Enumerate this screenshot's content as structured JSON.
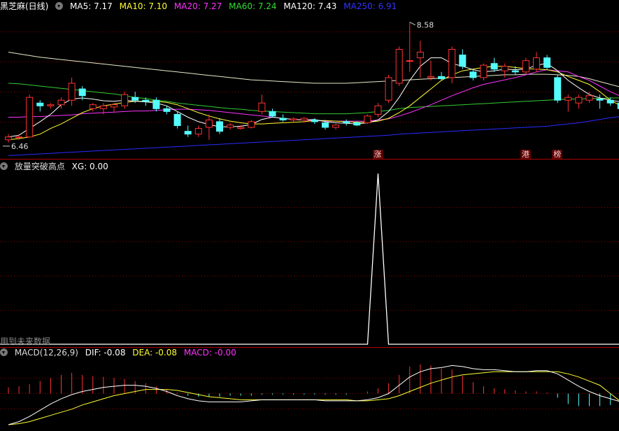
{
  "header1": {
    "title": "黑芝麻(日线)",
    "items": [
      {
        "label": "MA5: 7.17",
        "color": "#ffffff"
      },
      {
        "label": "MA10: 7.10",
        "color": "#ffff33"
      },
      {
        "label": "MA20: 7.27",
        "color": "#ff33ff"
      },
      {
        "label": "MA60: 7.24",
        "color": "#33dd33"
      },
      {
        "label": "MA120: 7.43",
        "color": "#ffffff"
      },
      {
        "label": "MA250: 6.91",
        "color": "#3333ff"
      }
    ]
  },
  "header2": {
    "title": "放量突破高点",
    "items": [
      {
        "label": "XG: 0.00",
        "color": "#ffffff"
      }
    ]
  },
  "header3": {
    "title": "MACD(12,26,9)",
    "items": [
      {
        "label": "DIF: -0.08",
        "color": "#ffffff"
      },
      {
        "label": "DEA: -0.08",
        "color": "#ffff33"
      },
      {
        "label": "MACD: -0.00",
        "color": "#ff33ff"
      }
    ]
  },
  "future_note": "用到未来数据",
  "badges": [
    {
      "text": "涨",
      "bar": 35
    },
    {
      "text": "港",
      "bar": 49
    },
    {
      "text": "榜",
      "bar": 52
    }
  ],
  "price_labels": {
    "high": "8.58",
    "low": "6.46"
  },
  "colors": {
    "up": "#ff3232",
    "down": "#54fcfc",
    "grid": "#8b0000"
  },
  "chart_data": [
    {
      "type": "candlestick",
      "series_names": [
        "MA5",
        "MA10",
        "MA20",
        "MA60",
        "MA120",
        "MA250"
      ],
      "ylim": [
        6.2,
        8.75
      ],
      "candles": [
        [
          6.5,
          6.6,
          6.45,
          6.55
        ],
        [
          6.55,
          6.6,
          6.5,
          6.55
        ],
        [
          6.55,
          7.3,
          6.55,
          7.25
        ],
        [
          7.15,
          7.2,
          7.0,
          7.1
        ],
        [
          7.1,
          7.15,
          7.05,
          7.12
        ],
        [
          7.12,
          7.25,
          7.05,
          7.2
        ],
        [
          7.2,
          7.6,
          7.1,
          7.5
        ],
        [
          7.4,
          7.45,
          7.2,
          7.28
        ],
        [
          7.05,
          7.15,
          7.0,
          7.12
        ],
        [
          7.05,
          7.15,
          6.95,
          7.1
        ],
        [
          7.08,
          7.15,
          7.0,
          7.12
        ],
        [
          7.1,
          7.35,
          7.05,
          7.3
        ],
        [
          7.25,
          7.35,
          7.15,
          7.2
        ],
        [
          7.2,
          7.25,
          7.1,
          7.18
        ],
        [
          7.2,
          7.25,
          7.0,
          7.05
        ],
        [
          7.05,
          7.1,
          6.95,
          7.0
        ],
        [
          6.95,
          7.0,
          6.7,
          6.75
        ],
        [
          6.65,
          6.75,
          6.55,
          6.6
        ],
        [
          6.6,
          6.75,
          6.55,
          6.7
        ],
        [
          6.72,
          6.95,
          6.5,
          6.85
        ],
        [
          6.82,
          6.88,
          6.6,
          6.65
        ],
        [
          6.72,
          6.8,
          6.68,
          6.76
        ],
        [
          6.7,
          6.76,
          6.68,
          6.72
        ],
        [
          6.72,
          6.85,
          6.7,
          6.82
        ],
        [
          7.0,
          7.3,
          6.95,
          7.15
        ],
        [
          7.0,
          7.05,
          6.9,
          6.92
        ],
        [
          6.88,
          6.95,
          6.82,
          6.85
        ],
        [
          6.85,
          6.9,
          6.82,
          6.87
        ],
        [
          6.85,
          6.9,
          6.8,
          6.88
        ],
        [
          6.85,
          6.88,
          6.78,
          6.82
        ],
        [
          6.8,
          6.85,
          6.68,
          6.72
        ],
        [
          6.72,
          6.78,
          6.68,
          6.76
        ],
        [
          6.82,
          6.86,
          6.75,
          6.8
        ],
        [
          6.8,
          6.83,
          6.74,
          6.76
        ],
        [
          6.8,
          6.95,
          6.78,
          6.92
        ],
        [
          6.95,
          7.15,
          6.9,
          7.1
        ],
        [
          7.2,
          7.65,
          7.15,
          7.6
        ],
        [
          7.5,
          8.15,
          7.45,
          8.1
        ],
        [
          7.9,
          8.58,
          7.7,
          7.9
        ],
        [
          7.95,
          8.25,
          7.6,
          8.05
        ],
        [
          7.6,
          7.9,
          7.55,
          7.62
        ],
        [
          7.62,
          7.7,
          7.55,
          7.58
        ],
        [
          7.6,
          8.15,
          7.5,
          8.1
        ],
        [
          8.0,
          8.1,
          7.75,
          7.8
        ],
        [
          7.7,
          7.75,
          7.55,
          7.6
        ],
        [
          7.6,
          7.85,
          7.55,
          7.82
        ],
        [
          7.85,
          7.95,
          7.7,
          7.75
        ],
        [
          7.72,
          7.85,
          7.6,
          7.8
        ],
        [
          7.72,
          7.8,
          7.65,
          7.7
        ],
        [
          7.7,
          7.95,
          7.65,
          7.9
        ],
        [
          7.75,
          8.05,
          7.7,
          7.95
        ],
        [
          7.95,
          8.0,
          7.75,
          7.78
        ],
        [
          7.6,
          7.65,
          7.15,
          7.2
        ],
        [
          7.2,
          7.3,
          7.0,
          7.25
        ],
        [
          7.15,
          7.3,
          7.05,
          7.25
        ],
        [
          7.2,
          7.35,
          7.15,
          7.28
        ],
        [
          7.22,
          7.3,
          7.05,
          7.2
        ],
        [
          7.2,
          7.25,
          7.1,
          7.15
        ],
        [
          7.15,
          7.2,
          6.95,
          7.05
        ]
      ],
      "ma5": [
        6.55,
        6.58,
        6.7,
        6.82,
        6.95,
        7.12,
        7.22,
        7.24,
        7.22,
        7.19,
        7.18,
        7.2,
        7.18,
        7.17,
        7.15,
        7.1,
        7.0,
        6.9,
        6.82,
        6.77,
        6.73,
        6.73,
        6.74,
        6.77,
        6.86,
        6.9,
        6.88,
        6.86,
        6.85,
        6.86,
        6.82,
        6.8,
        6.79,
        6.78,
        6.8,
        6.85,
        7.0,
        7.25,
        7.55,
        7.8,
        7.95,
        7.95,
        7.85,
        7.8,
        7.74,
        7.7,
        7.72,
        7.75,
        7.74,
        7.75,
        7.82,
        7.85,
        7.72,
        7.55,
        7.42,
        7.3,
        7.24,
        7.2,
        7.17
      ],
      "ma10": [
        6.5,
        6.52,
        6.55,
        6.6,
        6.7,
        6.78,
        6.88,
        6.98,
        7.05,
        7.1,
        7.13,
        7.16,
        7.18,
        7.18,
        7.18,
        7.16,
        7.12,
        7.05,
        6.98,
        6.92,
        6.87,
        6.83,
        6.8,
        6.78,
        6.78,
        6.79,
        6.8,
        6.81,
        6.82,
        6.84,
        6.84,
        6.83,
        6.82,
        6.81,
        6.81,
        6.83,
        6.88,
        6.98,
        7.1,
        7.25,
        7.4,
        7.55,
        7.65,
        7.72,
        7.75,
        7.78,
        7.8,
        7.8,
        7.78,
        7.76,
        7.75,
        7.74,
        7.7,
        7.62,
        7.55,
        7.48,
        7.35,
        7.2,
        7.1
      ],
      "ma20": [
        6.9,
        6.9,
        6.91,
        6.91,
        6.92,
        6.93,
        6.94,
        6.96,
        6.97,
        6.98,
        6.99,
        7.0,
        7.01,
        7.01,
        7.02,
        7.03,
        7.04,
        7.04,
        7.03,
        7.02,
        7.0,
        6.98,
        6.96,
        6.94,
        6.92,
        6.9,
        6.88,
        6.86,
        6.85,
        6.84,
        6.83,
        6.83,
        6.83,
        6.83,
        6.83,
        6.85,
        6.87,
        6.92,
        6.98,
        7.05,
        7.12,
        7.2,
        7.28,
        7.35,
        7.42,
        7.48,
        7.52,
        7.56,
        7.6,
        7.65,
        7.7,
        7.74,
        7.72,
        7.7,
        7.62,
        7.55,
        7.45,
        7.35,
        7.27
      ],
      "ma60": [
        7.5,
        7.49,
        7.47,
        7.45,
        7.43,
        7.41,
        7.39,
        7.37,
        7.35,
        7.33,
        7.31,
        7.28,
        7.25,
        7.23,
        7.2,
        7.18,
        7.15,
        7.13,
        7.11,
        7.09,
        7.07,
        7.05,
        7.04,
        7.02,
        7.01,
        7.0,
        6.99,
        6.98,
        6.97,
        6.96,
        6.96,
        6.96,
        6.96,
        6.97,
        6.98,
        7.0,
        7.02,
        7.05,
        7.07,
        7.08,
        7.09,
        7.1,
        7.11,
        7.12,
        7.13,
        7.14,
        7.15,
        7.16,
        7.17,
        7.18,
        7.19,
        7.2,
        7.21,
        7.22,
        7.22,
        7.23,
        7.23,
        7.24,
        7.24
      ],
      "ma120": [
        8.05,
        8.02,
        7.99,
        7.96,
        7.94,
        7.92,
        7.9,
        7.88,
        7.86,
        7.84,
        7.82,
        7.8,
        7.78,
        7.76,
        7.74,
        7.72,
        7.7,
        7.68,
        7.66,
        7.64,
        7.62,
        7.6,
        7.58,
        7.56,
        7.55,
        7.54,
        7.53,
        7.52,
        7.51,
        7.5,
        7.5,
        7.5,
        7.5,
        7.51,
        7.52,
        7.53,
        7.54,
        7.55,
        7.56,
        7.57,
        7.58,
        7.59,
        7.6,
        7.61,
        7.62,
        7.63,
        7.64,
        7.65,
        7.65,
        7.66,
        7.66,
        7.66,
        7.65,
        7.64,
        7.62,
        7.58,
        7.53,
        7.48,
        7.43
      ],
      "ma250": [
        6.22,
        6.23,
        6.24,
        6.25,
        6.26,
        6.27,
        6.28,
        6.29,
        6.3,
        6.31,
        6.32,
        6.33,
        6.34,
        6.35,
        6.36,
        6.37,
        6.38,
        6.39,
        6.4,
        6.41,
        6.42,
        6.43,
        6.44,
        6.45,
        6.46,
        6.47,
        6.48,
        6.49,
        6.5,
        6.51,
        6.52,
        6.53,
        6.54,
        6.55,
        6.56,
        6.57,
        6.58,
        6.6,
        6.61,
        6.62,
        6.63,
        6.64,
        6.65,
        6.66,
        6.67,
        6.68,
        6.69,
        6.7,
        6.71,
        6.72,
        6.73,
        6.74,
        6.76,
        6.78,
        6.8,
        6.83,
        6.86,
        6.89,
        6.91
      ]
    },
    {
      "type": "line",
      "series_names": [
        "XG"
      ],
      "ylim": [
        0,
        1
      ],
      "xg_signal_bar": 35,
      "xg": [
        0,
        0,
        0,
        0,
        0,
        0,
        0,
        0,
        0,
        0,
        0,
        0,
        0,
        0,
        0,
        0,
        0,
        0,
        0,
        0,
        0,
        0,
        0,
        0,
        0,
        0,
        0,
        0,
        0,
        0,
        0,
        0,
        0,
        0,
        0,
        1,
        0,
        0,
        0,
        0,
        0,
        0,
        0,
        0,
        0,
        0,
        0,
        0,
        0,
        0,
        0,
        0,
        0,
        0,
        0,
        0,
        0,
        0,
        0
      ]
    },
    {
      "type": "line",
      "series_names": [
        "DIF",
        "DEA",
        "MACD"
      ],
      "ylim": [
        -0.32,
        0.32
      ],
      "dif": [
        -0.3,
        -0.27,
        -0.22,
        -0.16,
        -0.1,
        -0.05,
        -0.01,
        0.02,
        0.04,
        0.06,
        0.07,
        0.08,
        0.08,
        0.07,
        0.05,
        0.02,
        -0.02,
        -0.05,
        -0.07,
        -0.08,
        -0.08,
        -0.08,
        -0.08,
        -0.07,
        -0.06,
        -0.06,
        -0.06,
        -0.06,
        -0.06,
        -0.06,
        -0.07,
        -0.07,
        -0.07,
        -0.07,
        -0.06,
        -0.04,
        0.0,
        0.08,
        0.16,
        0.21,
        0.24,
        0.25,
        0.27,
        0.26,
        0.24,
        0.23,
        0.23,
        0.22,
        0.21,
        0.21,
        0.22,
        0.22,
        0.19,
        0.13,
        0.07,
        0.02,
        -0.02,
        -0.05,
        -0.08
      ],
      "dea": [
        -0.3,
        -0.29,
        -0.27,
        -0.24,
        -0.21,
        -0.18,
        -0.15,
        -0.11,
        -0.08,
        -0.05,
        -0.02,
        0.0,
        0.02,
        0.04,
        0.04,
        0.04,
        0.03,
        0.01,
        -0.01,
        -0.03,
        -0.04,
        -0.05,
        -0.06,
        -0.06,
        -0.06,
        -0.06,
        -0.06,
        -0.06,
        -0.06,
        -0.06,
        -0.06,
        -0.06,
        -0.06,
        -0.07,
        -0.07,
        -0.06,
        -0.05,
        -0.02,
        0.02,
        0.06,
        0.1,
        0.13,
        0.16,
        0.18,
        0.19,
        0.2,
        0.21,
        0.21,
        0.21,
        0.21,
        0.21,
        0.21,
        0.21,
        0.19,
        0.16,
        0.12,
        0.08,
        0.0,
        -0.08
      ],
      "macd": [
        0.06,
        0.07,
        0.09,
        0.12,
        0.15,
        0.18,
        0.2,
        0.18,
        0.17,
        0.16,
        0.15,
        0.14,
        0.12,
        0.1,
        0.07,
        0.04,
        0.01,
        -0.02,
        -0.03,
        -0.03,
        -0.03,
        -0.02,
        -0.02,
        -0.02,
        -0.01,
        -0.01,
        -0.01,
        -0.01,
        -0.01,
        -0.01,
        -0.01,
        -0.01,
        -0.01,
        0.0,
        0.02,
        0.05,
        0.1,
        0.18,
        0.26,
        0.28,
        0.27,
        0.24,
        0.23,
        0.17,
        0.11,
        0.07,
        0.05,
        0.04,
        0.03,
        0.02,
        0.02,
        0.01,
        -0.04,
        -0.1,
        -0.12,
        -0.12,
        -0.12,
        -0.11,
        -0.12
      ]
    }
  ]
}
